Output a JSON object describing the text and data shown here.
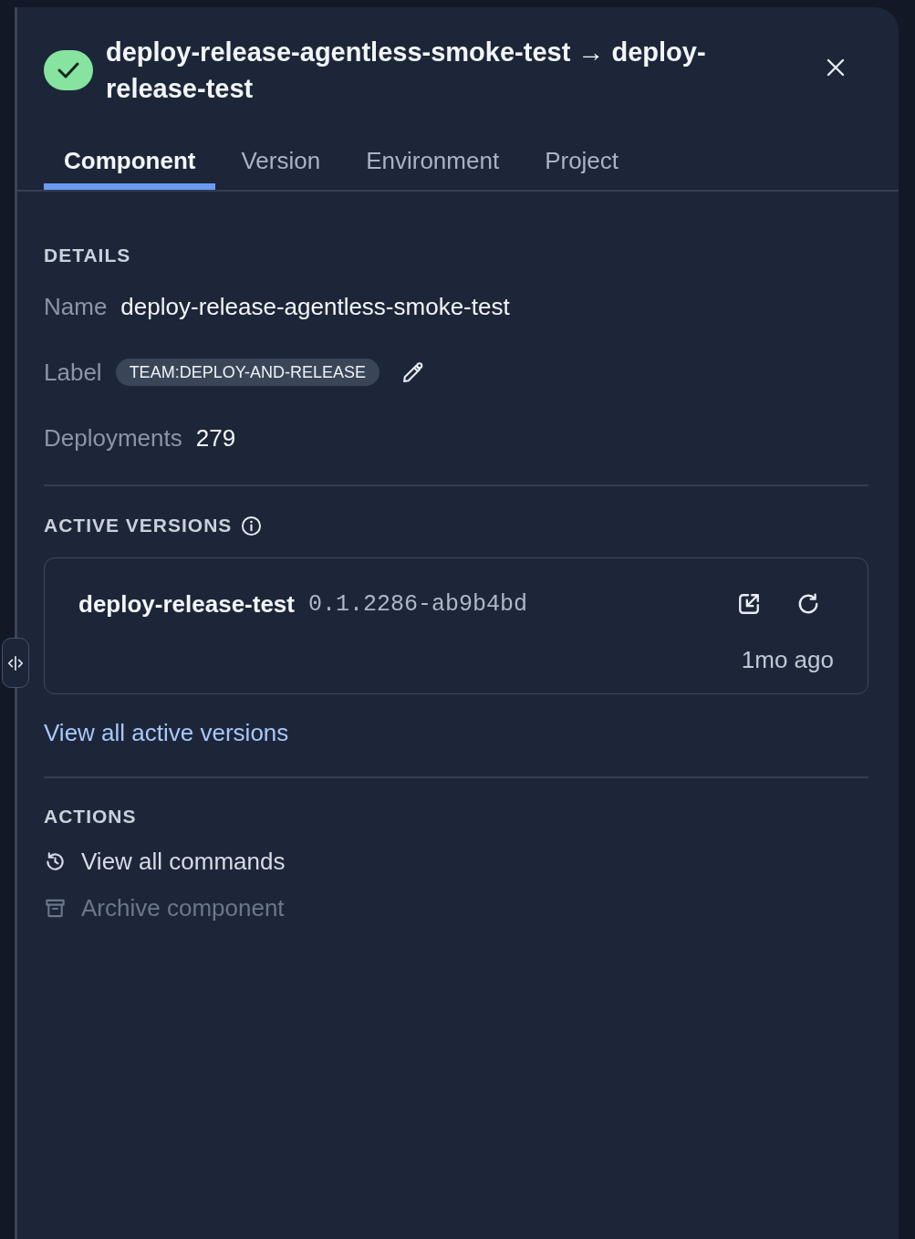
{
  "header": {
    "passed": true,
    "title": "deploy-release-agentless-smoke-test → deploy-release-test"
  },
  "tabs": [
    {
      "label": "Component",
      "selected": true
    },
    {
      "label": "Version",
      "selected": false
    },
    {
      "label": "Environment",
      "selected": false
    },
    {
      "label": "Project",
      "selected": false
    }
  ],
  "details": {
    "heading": "DETAILS",
    "fields": [
      {
        "kind": "text",
        "label": "Name",
        "value": "deploy-release-agentless-smoke-test"
      },
      {
        "kind": "tag",
        "label": "Label",
        "value": "TEAM:DEPLOY-AND-RELEASE"
      },
      {
        "kind": "text",
        "label": "Deployments",
        "value": "279"
      }
    ]
  },
  "active_versions": {
    "heading": "ACTIVE VERSIONS",
    "versions": [
      {
        "name": "deploy-release-test",
        "version": "0.1.2286-ab9b4bd",
        "age": "1mo ago"
      }
    ],
    "link": "View all active versions"
  },
  "actions": {
    "heading": "ACTIONS",
    "items": [
      {
        "kind": "history",
        "label": "View all commands",
        "disabled": false
      },
      {
        "kind": "archive",
        "label": "Archive component",
        "disabled": true
      }
    ]
  }
}
